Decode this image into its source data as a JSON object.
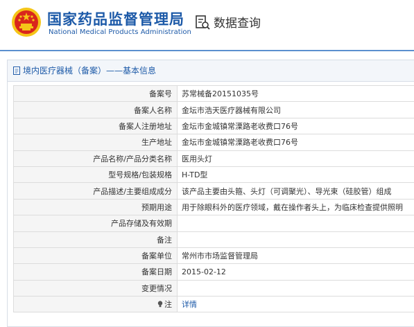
{
  "header": {
    "org_name_cn": "国家药品监督管理局",
    "org_name_en": "National Medical Products Administration",
    "query_label": "数据查询"
  },
  "panel": {
    "title": "境内医疗器械（备案）——基本信息"
  },
  "rows": [
    {
      "label": "备案号",
      "value": "苏常械备20151035号"
    },
    {
      "label": "备案人名称",
      "value": "金坛市浩天医疗器械有限公司"
    },
    {
      "label": "备案人注册地址",
      "value": "金坛市金城镇常溧路老收费口76号"
    },
    {
      "label": "生产地址",
      "value": "金坛市金城镇常溧路老收费口76号"
    },
    {
      "label": "产品名称/产品分类名称",
      "value": "医用头灯"
    },
    {
      "label": "型号规格/包装规格",
      "value": "H-TD型"
    },
    {
      "label": "产品描述/主要组成成分",
      "value": "该产品主要由头箍、头灯（可调聚光）、导光束（硅胶管）组成"
    },
    {
      "label": "预期用途",
      "value": "用于除眼科外的医疗领域，戴在操作者头上，为临床检查提供照明"
    },
    {
      "label": "产品存储及有效期",
      "value": ""
    },
    {
      "label": "备注",
      "value": ""
    },
    {
      "label": "备案单位",
      "value": "常州市市场监督管理局"
    },
    {
      "label": "备案日期",
      "value": "2015-02-12"
    },
    {
      "label": "变更情况",
      "value": ""
    },
    {
      "label": "注",
      "value": "详情",
      "icon": "lightbulb-icon"
    }
  ],
  "colors": {
    "brand_blue": "#1d5aa8",
    "emblem_red": "#d9261c",
    "emblem_gold": "#f5c518"
  }
}
